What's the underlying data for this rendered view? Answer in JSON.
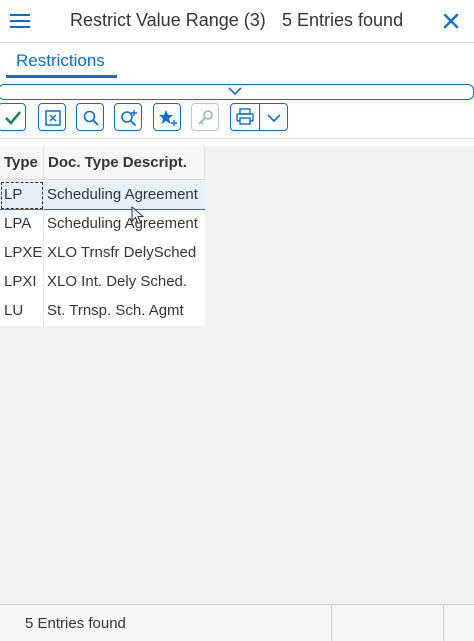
{
  "window": {
    "title": "Restrict Value Range (3)",
    "entries_found": "5 Entries found"
  },
  "tabs": [
    {
      "label": "Restrictions",
      "active": true
    }
  ],
  "toolbar": {
    "buttons": [
      {
        "name": "continue",
        "icon": "checkmark-icon"
      },
      {
        "name": "cancel",
        "icon": "cancel-box-icon"
      },
      {
        "name": "find",
        "icon": "search-icon"
      },
      {
        "name": "find-next",
        "icon": "search-plus-icon"
      },
      {
        "name": "add-favorite",
        "icon": "star-plus-icon"
      },
      {
        "name": "hide-restrictions",
        "icon": "key-link-icon",
        "disabled": true
      },
      {
        "name": "print",
        "icon": "printer-icon"
      },
      {
        "name": "more",
        "icon": "chevron-down-icon"
      }
    ]
  },
  "table": {
    "columns": [
      "Type",
      "Doc. Type Descript."
    ],
    "rows": [
      {
        "type": "LP",
        "desc": "Scheduling Agreement",
        "selected": true
      },
      {
        "type": "LPA",
        "desc": "Scheduling Agreement",
        "selected": false
      },
      {
        "type": "LPXE",
        "desc": "XLO Trnsfr DelySched",
        "selected": false
      },
      {
        "type": "LPXI",
        "desc": "XLO Int. Dely Sched.",
        "selected": false
      },
      {
        "type": "LU",
        "desc": "St. Trnsp. Sch. Agmt",
        "selected": false
      }
    ]
  },
  "status": {
    "text": "5 Entries found"
  },
  "colors": {
    "accent": "#0a6ed1",
    "check_green": "#107e3e",
    "text": "#32363a"
  }
}
